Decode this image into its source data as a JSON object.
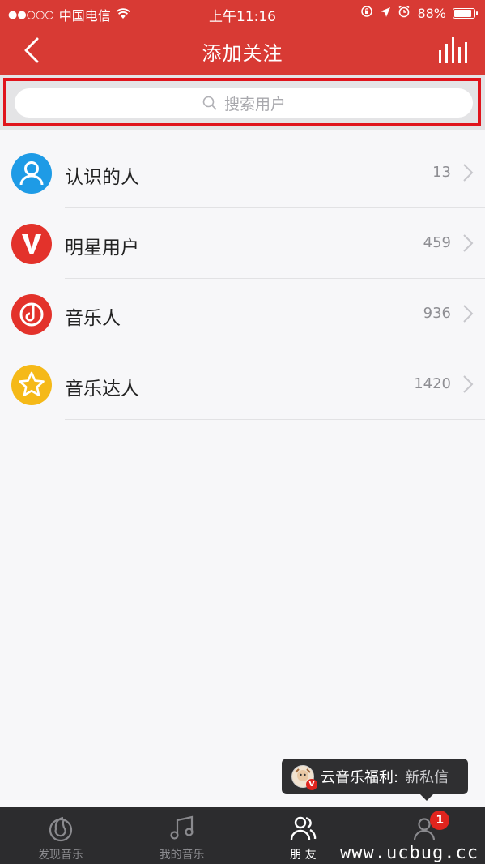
{
  "status_bar": {
    "signal": "●●○○○",
    "carrier": "中国电信",
    "time": "上午11:16",
    "battery": "88%",
    "battery_level": 0.88
  },
  "nav": {
    "title": "添加关注"
  },
  "search": {
    "placeholder": "搜索用户"
  },
  "list": {
    "items": [
      {
        "label": "认识的人",
        "count": "13",
        "color": "#1e9be6"
      },
      {
        "label": "明星用户",
        "count": "459",
        "color": "#e3322b"
      },
      {
        "label": "音乐人",
        "count": "936",
        "color": "#e3322b"
      },
      {
        "label": "音乐达人",
        "count": "1420",
        "color": "#f5b918"
      }
    ]
  },
  "toast": {
    "prefix": "云音乐福利:",
    "message": "新私信",
    "badge_letter": "V"
  },
  "tabbar": {
    "tabs": [
      {
        "label": "发现音乐"
      },
      {
        "label": "我的音乐"
      },
      {
        "label": "朋 友"
      },
      {
        "label": ""
      }
    ],
    "account_badge": "1"
  },
  "watermark": "www.ucbug.cc"
}
